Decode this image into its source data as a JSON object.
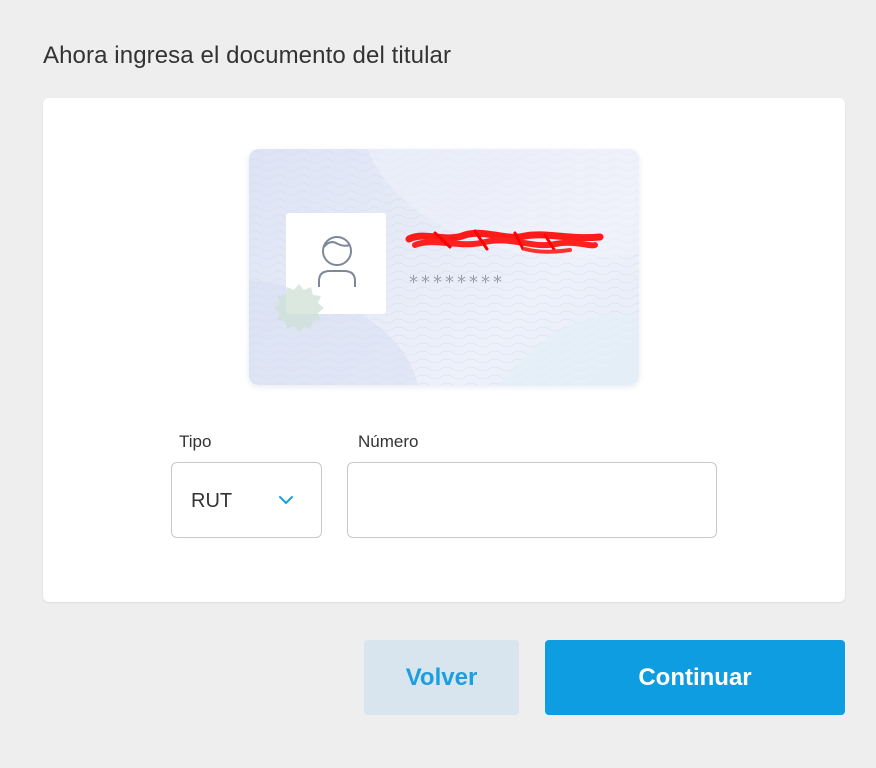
{
  "page": {
    "title": "Ahora ingresa el documento del titular"
  },
  "id_card": {
    "masked_number": "********",
    "name_redacted": true
  },
  "form": {
    "tipo_label": "Tipo",
    "tipo_value": "RUT",
    "numero_label": "Número",
    "numero_value": "",
    "numero_placeholder": ""
  },
  "actions": {
    "back_label": "Volver",
    "continue_label": "Continuar"
  },
  "colors": {
    "primary": "#0d9de0",
    "secondary_bg": "#d8e5ee",
    "page_bg": "#eeeeee",
    "redaction": "#ff0000"
  },
  "icons": {
    "avatar": "user-avatar-icon",
    "seal": "seal-icon",
    "dropdown": "chevron-down-icon"
  }
}
